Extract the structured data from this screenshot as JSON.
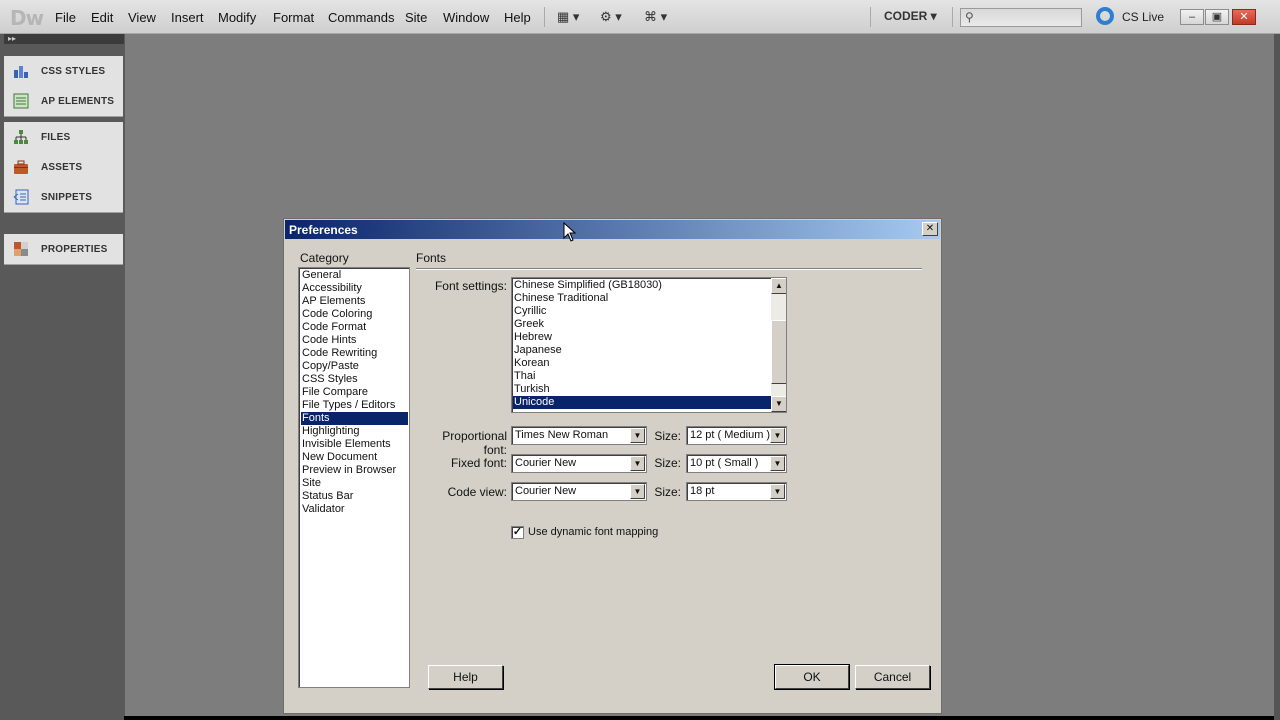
{
  "app": {
    "logo": "Dw",
    "menu": [
      "File",
      "Edit",
      "View",
      "Insert",
      "Modify",
      "Format",
      "Commands",
      "Site",
      "Window",
      "Help"
    ],
    "workspace": "CODER",
    "cslive": "CS Live"
  },
  "dock": {
    "groups": [
      [
        {
          "label": "CSS STYLES",
          "icon": "css-styles-icon"
        },
        {
          "label": "AP ELEMENTS",
          "icon": "ap-elements-icon"
        }
      ],
      [
        {
          "label": "FILES",
          "icon": "files-icon"
        },
        {
          "label": "ASSETS",
          "icon": "assets-icon"
        },
        {
          "label": "SNIPPETS",
          "icon": "snippets-icon"
        }
      ],
      [
        {
          "label": "PROPERTIES",
          "icon": "properties-icon"
        }
      ]
    ]
  },
  "dialog": {
    "title": "Preferences",
    "category_label": "Category",
    "categories": [
      "General",
      "Accessibility",
      "AP Elements",
      "Code Coloring",
      "Code Format",
      "Code Hints",
      "Code Rewriting",
      "Copy/Paste",
      "CSS Styles",
      "File Compare",
      "File Types / Editors",
      "Fonts",
      "Highlighting",
      "Invisible Elements",
      "New Document",
      "Preview in Browser",
      "Site",
      "Status Bar",
      "Validator"
    ],
    "selected_category": "Fonts",
    "section_title": "Fonts",
    "font_settings_label": "Font settings:",
    "font_settings": [
      "Chinese Simplified (GB18030)",
      "Chinese Traditional",
      "Cyrillic",
      "Greek",
      "Hebrew",
      "Japanese",
      "Korean",
      "Thai",
      "Turkish",
      "Unicode"
    ],
    "selected_font_setting": "Unicode",
    "proportional": {
      "label": "Proportional font:",
      "value": "Times New Roman",
      "size_label": "Size:",
      "size": "12 pt  ( Medium )"
    },
    "fixed": {
      "label": "Fixed font:",
      "value": "Courier New",
      "size_label": "Size:",
      "size": "10 pt  ( Small )"
    },
    "code_view": {
      "label": "Code view:",
      "value": "Courier New",
      "size_label": "Size:",
      "size": "18 pt"
    },
    "dynamic_mapping": {
      "label": "Use dynamic font mapping",
      "checked": true
    },
    "buttons": {
      "help": "Help",
      "ok": "OK",
      "cancel": "Cancel"
    }
  },
  "colors": {
    "selection": "#0a246a",
    "dialog_bg": "#d4d0c8",
    "workspace_bg": "#7d7d7d"
  }
}
